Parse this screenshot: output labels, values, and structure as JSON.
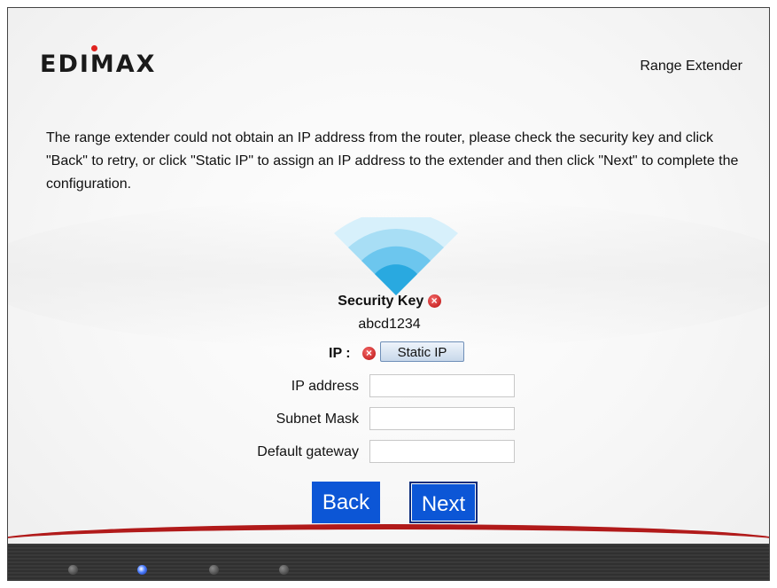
{
  "header": {
    "logo_text": "EDIMAX",
    "product": "Range Extender"
  },
  "message": "The range extender could not obtain an IP address from the router, please check the security key and click \"Back\" to retry, or click \"Static IP\" to assign an IP address to the extender and then click \"Next\" to complete the configuration.",
  "security": {
    "label": "Security Key",
    "value": "abcd1234",
    "status_icon": "error-icon"
  },
  "ip": {
    "label": "IP :",
    "status_icon": "error-icon",
    "static_button": "Static IP"
  },
  "fields": {
    "ip_address": {
      "label": "IP address",
      "value": ""
    },
    "subnet_mask": {
      "label": "Subnet Mask",
      "value": ""
    },
    "default_gateway": {
      "label": "Default gateway",
      "value": ""
    }
  },
  "buttons": {
    "back": "Back",
    "next": "Next"
  },
  "progress": {
    "steps": 4,
    "current_step": 2
  },
  "colors": {
    "primary_button": "#0c56d6",
    "error": "#d32f2f",
    "wifi": "#29a9e0",
    "footer_accent": "#b11a1a"
  }
}
